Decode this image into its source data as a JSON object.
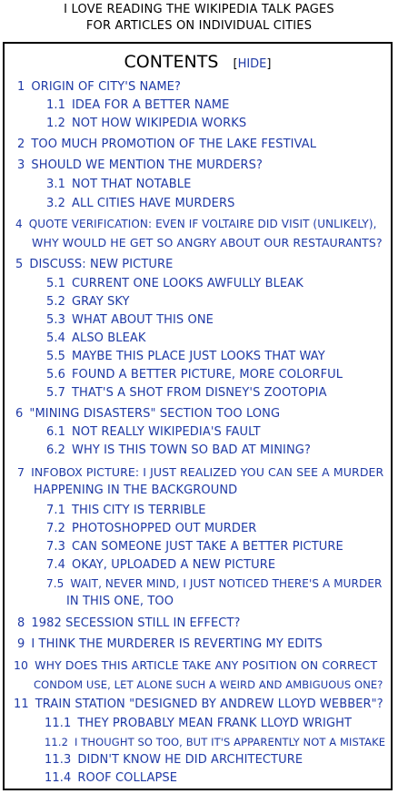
{
  "caption": {
    "line1": "I LOVE READING THE WIKIPEDIA TALK PAGES",
    "line2": "FOR ARTICLES ON INDIVIDUAL CITIES"
  },
  "toc": {
    "title": "CONTENTS",
    "hide_open": "[",
    "hide_label": "HIDE",
    "hide_close": "]",
    "items": [
      {
        "num": "1",
        "text": "ORIGIN OF CITY'S NAME?"
      },
      {
        "num": "1.1",
        "text": "IDEA FOR A BETTER NAME"
      },
      {
        "num": "1.2",
        "text": "NOT HOW WIKIPEDIA WORKS"
      },
      {
        "num": "2",
        "text": "TOO MUCH PROMOTION OF THE LAKE FESTIVAL"
      },
      {
        "num": "3",
        "text": "SHOULD WE MENTION THE MURDERS?"
      },
      {
        "num": "3.1",
        "text": "NOT THAT NOTABLE"
      },
      {
        "num": "3.2",
        "text": "ALL CITIES HAVE MURDERS"
      },
      {
        "num": "4",
        "text": "QUOTE VERIFICATION: EVEN IF VOLTAIRE DID VISIT (UNLIKELY),",
        "text2": "WHY WOULD HE GET SO ANGRY ABOUT OUR RESTAURANTS?"
      },
      {
        "num": "5",
        "text": "DISCUSS: NEW PICTURE"
      },
      {
        "num": "5.1",
        "text": "CURRENT ONE LOOKS AWFULLY BLEAK"
      },
      {
        "num": "5.2",
        "text": "GRAY SKY"
      },
      {
        "num": "5.3",
        "text": "WHAT ABOUT THIS ONE"
      },
      {
        "num": "5.4",
        "text": "ALSO BLEAK"
      },
      {
        "num": "5.5",
        "text": "MAYBE THIS PLACE JUST LOOKS THAT WAY"
      },
      {
        "num": "5.6",
        "text": "FOUND A BETTER PICTURE, MORE COLORFUL"
      },
      {
        "num": "5.7",
        "text": "THAT'S A SHOT FROM DISNEY'S ZOOTOPIA"
      },
      {
        "num": "6",
        "text": "\"MINING DISASTERS\" SECTION TOO LONG"
      },
      {
        "num": "6.1",
        "text": "NOT REALLY WIKIPEDIA'S FAULT"
      },
      {
        "num": "6.2",
        "text": "WHY IS THIS TOWN SO BAD AT MINING?"
      },
      {
        "num": "7",
        "text": "INFOBOX PICTURE: I JUST REALIZED YOU CAN SEE A MURDER",
        "text2": "HAPPENING IN THE BACKGROUND"
      },
      {
        "num": "7.1",
        "text": "THIS CITY IS TERRIBLE"
      },
      {
        "num": "7.2",
        "text": "PHOTOSHOPPED OUT MURDER"
      },
      {
        "num": "7.3",
        "text": "CAN SOMEONE JUST TAKE A BETTER PICTURE"
      },
      {
        "num": "7.4",
        "text": "OKAY, UPLOADED A NEW PICTURE"
      },
      {
        "num": "7.5",
        "text": "WAIT, NEVER MIND, I JUST NOTICED THERE'S A MURDER",
        "text2": "IN THIS ONE, TOO"
      },
      {
        "num": "8",
        "text": "1982 SECESSION STILL IN EFFECT?"
      },
      {
        "num": "9",
        "text": "I THINK THE MURDERER IS REVERTING MY EDITS"
      },
      {
        "num": "10",
        "text": "WHY DOES THIS ARTICLE TAKE ANY POSITION ON CORRECT",
        "text2": "CONDOM USE, LET ALONE SUCH A WEIRD AND AMBIGUOUS ONE?"
      },
      {
        "num": "11",
        "text": "TRAIN STATION \"DESIGNED BY ANDREW LLOYD WEBBER\"?"
      },
      {
        "num": "11.1",
        "text": "THEY PROBABLY MEAN FRANK LLOYD WRIGHT"
      },
      {
        "num": "11.2",
        "text": "I THOUGHT SO TOO, BUT IT'S APPARENTLY NOT A MISTAKE"
      },
      {
        "num": "11.3",
        "text": "DIDN'T KNOW HE DID ARCHITECTURE"
      },
      {
        "num": "11.4",
        "text": "ROOF COLLAPSE"
      }
    ]
  }
}
